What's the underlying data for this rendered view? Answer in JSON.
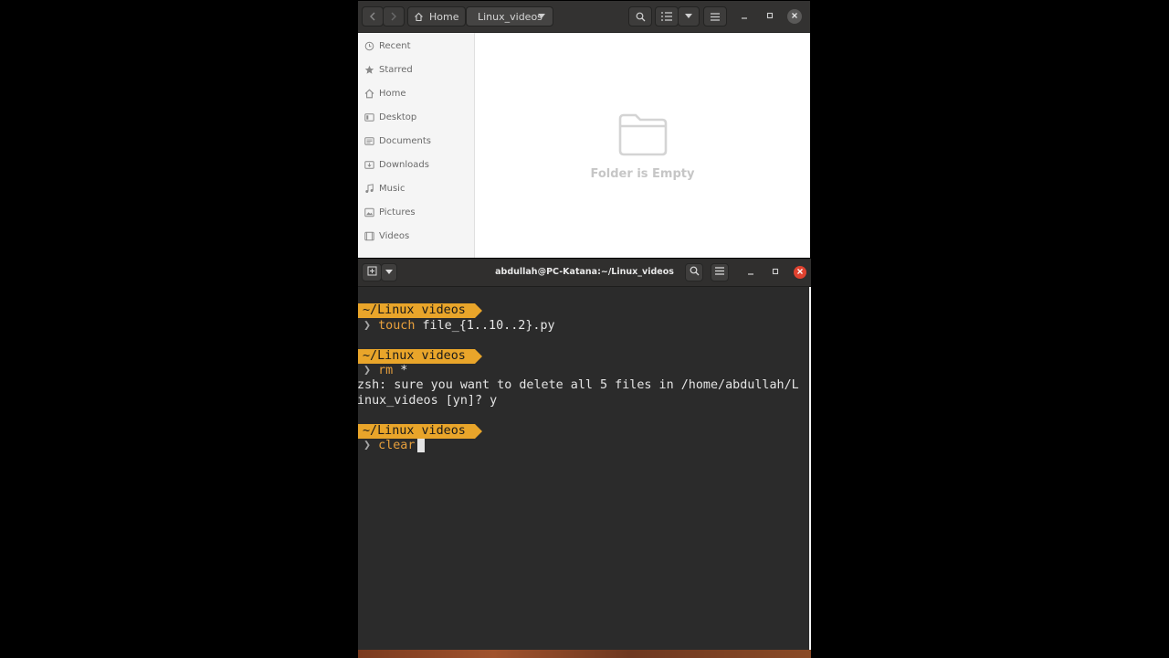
{
  "file_manager": {
    "nav": {
      "back_icon": "chevron-left-icon",
      "forward_icon": "chevron-right-icon"
    },
    "breadcrumb": {
      "home_label": "Home",
      "current_label": "Linux_videos"
    },
    "sidebar": {
      "items": [
        {
          "label": "Recent",
          "icon": "clock-icon"
        },
        {
          "label": "Starred",
          "icon": "star-icon"
        },
        {
          "label": "Home",
          "icon": "home-icon"
        },
        {
          "label": "Desktop",
          "icon": "desktop-icon"
        },
        {
          "label": "Documents",
          "icon": "document-icon"
        },
        {
          "label": "Downloads",
          "icon": "download-icon"
        },
        {
          "label": "Music",
          "icon": "music-icon"
        },
        {
          "label": "Pictures",
          "icon": "picture-icon"
        },
        {
          "label": "Videos",
          "icon": "video-icon"
        }
      ]
    },
    "empty_state": {
      "message": "Folder is Empty",
      "icon": "folder-icon"
    }
  },
  "terminal": {
    "title": "abdullah@PC-Katana:~/Linux_videos",
    "prompt_path": "~/Linux videos",
    "prompt_symbol": "❯",
    "blocks": [
      {
        "command": "touch",
        "args": " file_{1..10..2}.py"
      },
      {
        "command": "rm",
        "args": " *"
      },
      {
        "command": "clear",
        "args": ""
      }
    ],
    "output_lines": [
      "zsh: sure you want to delete all 5 files in /home/abdullah/L",
      "inux_videos [yn]? y"
    ]
  },
  "colors": {
    "prompt_bg": "#e9a52a",
    "command_fg": "#e8a03c",
    "terminal_bg": "#2b2b2b",
    "headerbar_bg": "#333231",
    "close_red": "#e0422f"
  }
}
